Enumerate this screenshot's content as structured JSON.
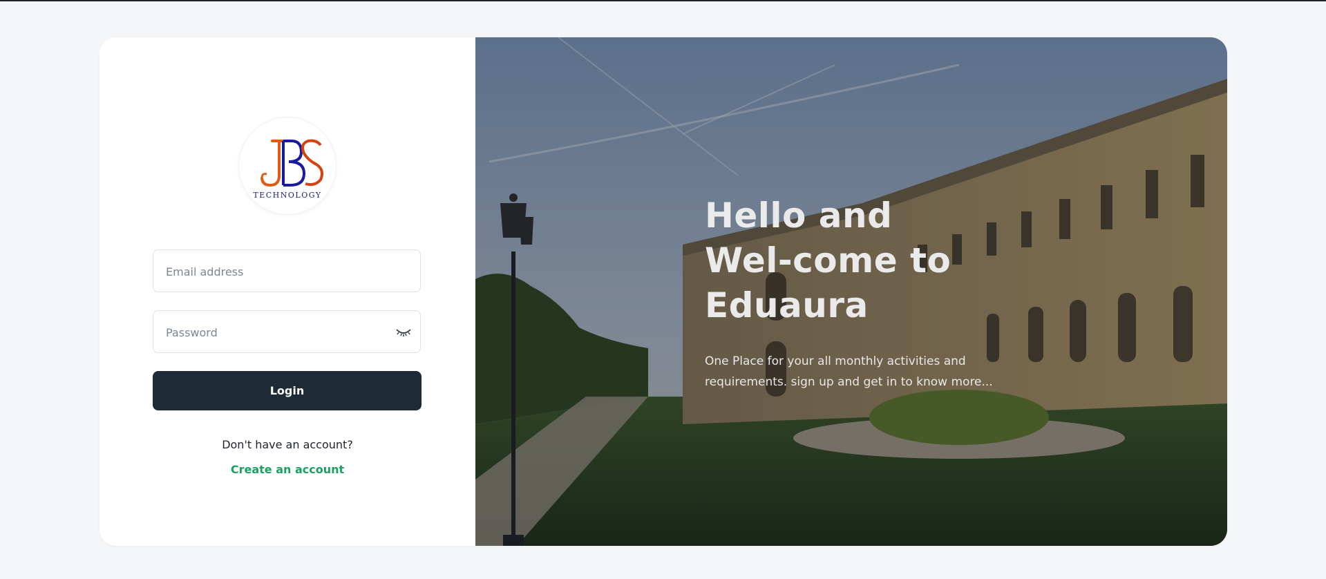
{
  "logo": {
    "letters": "JBS",
    "tagline": "TECHNOLOGY"
  },
  "form": {
    "email_placeholder": "Email address",
    "password_placeholder": "Password",
    "password_toggle_icon": "eye-closed-icon",
    "login_label": "Login",
    "no_account_text": "Don't have an account?",
    "create_account_label": "Create an account"
  },
  "hero": {
    "title": "Hello and Wel-come to Eduaura",
    "subtitle": "One Place for your all monthly activities and requirements. sign up and get in to know more..."
  },
  "colors": {
    "page_background": "#f4f5f7",
    "button_dark": "#1f2a37",
    "link_green": "#1aa05f"
  }
}
